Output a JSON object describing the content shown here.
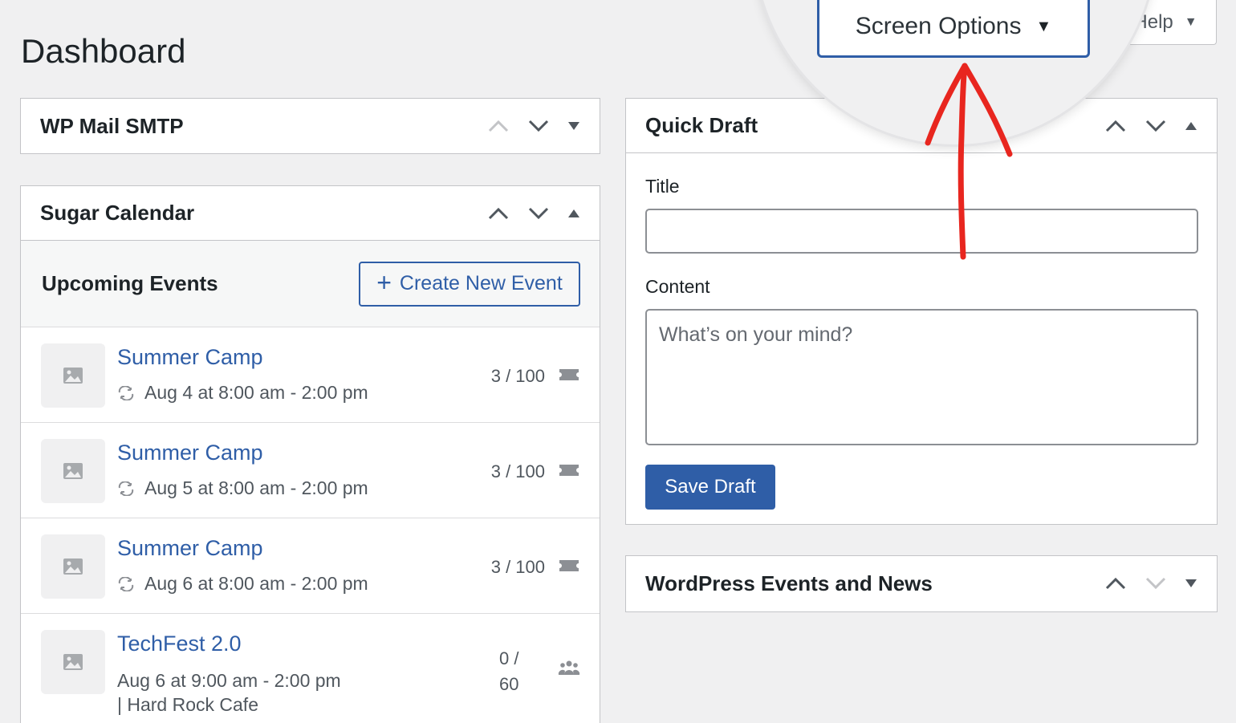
{
  "page": {
    "title": "Dashboard"
  },
  "top_tabs": {
    "screen_options_label": "Screen Options",
    "help_label": "Help"
  },
  "widgets": {
    "wp_mail_smtp": {
      "title": "WP Mail SMTP"
    },
    "sugar_calendar": {
      "title": "Sugar Calendar",
      "section_label": "Upcoming Events",
      "create_button_label": "Create New Event",
      "events": [
        {
          "title": "Summer Camp",
          "date": "Aug 4 at 8:00 am - 2:00 pm",
          "count": "3 / 100",
          "recurring": true,
          "icon": "ticket-icon"
        },
        {
          "title": "Summer Camp",
          "date": "Aug 5 at 8:00 am - 2:00 pm",
          "count": "3 / 100",
          "recurring": true,
          "icon": "ticket-icon"
        },
        {
          "title": "Summer Camp",
          "date": "Aug 6 at 8:00 am - 2:00 pm",
          "count": "3 / 100",
          "recurring": true,
          "icon": "ticket-icon"
        },
        {
          "title": "TechFest 2.0",
          "date": "Aug 6 at 9:00 am - 2:00 pm",
          "location": "| Hard Rock Cafe",
          "count_top": "0 /",
          "count_bottom": "60",
          "recurring": false,
          "icon": "people-icon"
        }
      ]
    },
    "quick_draft": {
      "title": "Quick Draft",
      "title_label": "Title",
      "title_value": "",
      "content_label": "Content",
      "content_placeholder": "What’s on your mind?",
      "save_label": "Save Draft"
    },
    "wp_events_news": {
      "title": "WordPress Events and News"
    }
  },
  "colors": {
    "accent": "#2f5ea7",
    "annotation_arrow": "#e8261f",
    "background": "#f0f0f1"
  }
}
